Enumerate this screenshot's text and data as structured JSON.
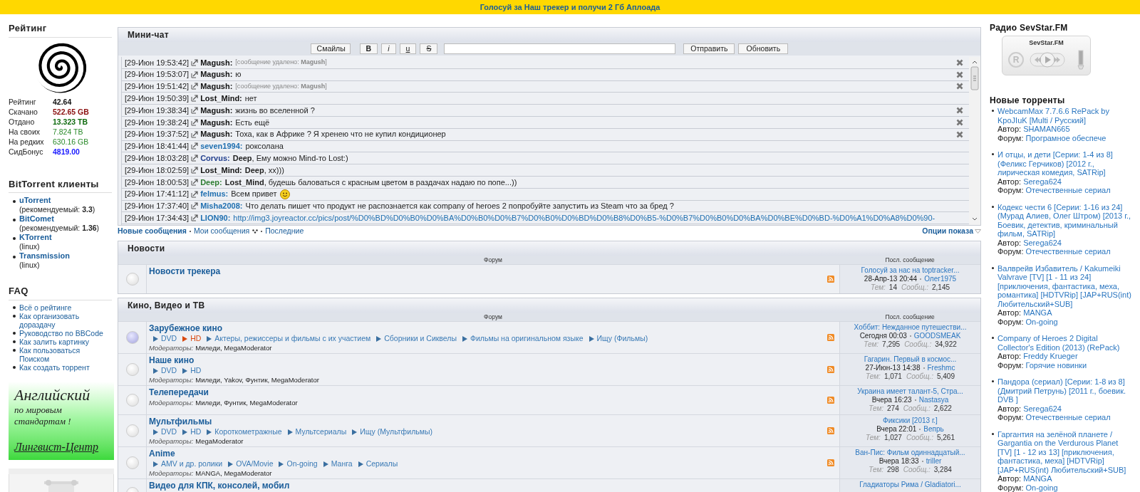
{
  "banner": {
    "text": "Голосуй за Наш трекер и получи 2 Гб Аплоада"
  },
  "left": {
    "rating": {
      "title": "Рейтинг",
      "stats": [
        {
          "label": "Рейтинг",
          "value": "42.64",
          "color": "#111111",
          "bold": true
        },
        {
          "label": "Скачано",
          "value": "522.65 GB",
          "color": "#8b1010",
          "bold": true
        },
        {
          "label": "Отдано",
          "value": "13.323 TB",
          "color": "#0f6b0f",
          "bold": true
        },
        {
          "label": "На своих",
          "value": "7.824 TB",
          "color": "#2a8a2a",
          "bold": false
        },
        {
          "label": "На редких",
          "value": "630.16 GB",
          "color": "#2a8a2a",
          "bold": false
        },
        {
          "label": "СидБонус",
          "value": "4819.00",
          "color": "#1a1aff",
          "bold": true
        }
      ]
    },
    "clients": {
      "title": "BitTorrent клиенты",
      "items": [
        {
          "name": "uTorrent",
          "note": "(рекомендуемый: **3.3**)"
        },
        {
          "name": "BitComet",
          "note": "(рекомендуемый: **1.36**)"
        },
        {
          "name": "KTorrent",
          "note": "(linux)"
        },
        {
          "name": "Transmission",
          "note": "(linux)"
        }
      ]
    },
    "faq": {
      "title": "FAQ",
      "links": [
        "Всё о рейтинге",
        "Как организовать дораздачу",
        "Руководство по BBCode",
        "Как залить картинку",
        "Как пользоваться Поиском",
        "Как создать торрент"
      ]
    },
    "ad": {
      "headline": "Английский",
      "tagline": "по мировым стандартам !",
      "brand": "Лингвист-Центр"
    }
  },
  "chat": {
    "title": "Мини-чат",
    "toolbar": {
      "smileys": "Смайлы",
      "bold": "B",
      "italic": "i",
      "underline": "u",
      "strike": "S",
      "send": "Отправить",
      "refresh": "Обновить"
    },
    "messages": [
      {
        "time": "[29-Июн 19:53:42]",
        "author": "Magush:",
        "color": "#111111",
        "kind": "deleted",
        "text": "[сообщение удалено: **Magush**]",
        "deletable": true
      },
      {
        "time": "[29-Июн 19:53:07]",
        "author": "Magush:",
        "color": "#111111",
        "kind": "text",
        "text": "ю",
        "deletable": true
      },
      {
        "time": "[29-Июн 19:51:42]",
        "author": "Magush:",
        "color": "#111111",
        "kind": "deleted",
        "text": "[сообщение удалено: **Magush**]",
        "deletable": true
      },
      {
        "time": "[29-Июн 19:50:39]",
        "author": "Lost_Mind:",
        "color": "#111111",
        "kind": "text",
        "text": "нет",
        "deletable": false
      },
      {
        "time": "[29-Июн 19:38:34]",
        "author": "Magush:",
        "color": "#111111",
        "kind": "text",
        "text": "жизнь во вселенной ?",
        "deletable": true
      },
      {
        "time": "[29-Июн 19:38:24]",
        "author": "Magush:",
        "color": "#111111",
        "kind": "text",
        "text": "Есть ещё",
        "deletable": true
      },
      {
        "time": "[29-Июн 19:37:52]",
        "author": "Magush:",
        "color": "#111111",
        "kind": "text",
        "text": "Тоха, как в Африке ? Я хренею что не купил кондиционер",
        "deletable": true
      },
      {
        "time": "[29-Июн 18:41:44]",
        "author": "seven1994:",
        "color": "#1f6fb0",
        "kind": "text",
        "text": "роксолана",
        "deletable": false
      },
      {
        "time": "[29-Июн 18:03:28]",
        "author": "Corvus:",
        "color": "#23408e",
        "kind": "text",
        "text": "**Deep**, Ему можно Mind-то Lost:)",
        "deletable": false
      },
      {
        "time": "[29-Июн 18:02:59]",
        "author": "Lost_Mind:",
        "color": "#111111",
        "kind": "text",
        "text": "**Deep**, xx)))",
        "deletable": false
      },
      {
        "time": "[29-Июн 18:00:53]",
        "author": "Deep:",
        "color": "#2e7d32",
        "kind": "text",
        "text": "**Lost_Mind**, будешь баловаться с красным цветом в раздачах надаю по попе...))",
        "deletable": false
      },
      {
        "time": "[29-Июн 17:41:12]",
        "author": "felmus:",
        "color": "#1f6fb0",
        "kind": "smiley",
        "text": "Всем привет",
        "deletable": false
      },
      {
        "time": "[29-Июн 17:37:40]",
        "author": "Misha2008:",
        "color": "#1f6fb0",
        "kind": "text",
        "text": "Что делать пишет что продукт не распознается как company of heroes 2 попробуйте запустить из Steam что за бред ?",
        "deletable": false
      },
      {
        "time": "[29-Июн 17:34:43]",
        "author": "LION90:",
        "color": "#1f6fb0",
        "kind": "link",
        "text": "http://img3.joyreactor.cc/pics/post/%D0%BD%D0%B0%D0%BA%D0%B0%D0%B7%D0%B0%D0%BD%D0%B8%D0%B5-%D0%B7%D0%B0%D0%BA%D0%BE%D0%BD-%D0%A1%D0%A8%D0%90-",
        "deletable": false
      }
    ],
    "footer": {
      "new": "Новые сообщения",
      "mine": "Мои сообщения",
      "recent": "Последние",
      "options": "Опции показа"
    }
  },
  "categories": [
    {
      "title": "Новости",
      "col_forum": "Форум",
      "col_last": "Посл. сообщение",
      "forums": [
        {
          "name": "Новости трекера",
          "unread": false,
          "last": {
            "title": "Голосуй за нас на toptracker...",
            "date": "28-Апр-13 20:44",
            "author": "Олег1975",
            "topics_label": "Тем:",
            "topics": "14",
            "posts_label": "Сообщ.:",
            "posts": "2,145"
          }
        }
      ]
    },
    {
      "title": "Кино, Видео и ТВ",
      "col_forum": "Форум",
      "col_last": "Посл. сообщение",
      "forums": [
        {
          "name": "Зарубежное кино",
          "unread": true,
          "subforums": [
            {
              "label": "DVD",
              "new": false
            },
            {
              "label": "HD",
              "new": true
            },
            {
              "label": "Актеры, режиссеры и фильмы с их участием",
              "new": false
            },
            {
              "label": "Сборники и Сиквелы",
              "new": false
            },
            {
              "label": "Фильмы на оригинальном языке",
              "new": false
            },
            {
              "label": "Ищу (Фильмы)",
              "new": false
            }
          ],
          "moderators_label": "Модераторы:",
          "moderators": "Миледи, MegaModerator",
          "last": {
            "title": "Хоббит: Нежданное путешестви...",
            "date": "Сегодня 00:03",
            "author": "GOODSMEAK",
            "topics_label": "Тем:",
            "topics": "7,295",
            "posts_label": "Сообщ.:",
            "posts": "34,922"
          }
        },
        {
          "name": "Наше кино",
          "unread": false,
          "subforums": [
            {
              "label": "DVD",
              "new": false
            },
            {
              "label": "HD",
              "new": false
            }
          ],
          "moderators_label": "Модераторы:",
          "moderators": "Миледи, Yakov, Фунтик, MegaModerator",
          "last": {
            "title": "Гагарин. Первый в космос...",
            "date": "27-Июн-13 14:38",
            "author": "Freshmc",
            "topics_label": "Тем:",
            "topics": "1,071",
            "posts_label": "Сообщ.:",
            "posts": "5,409"
          }
        },
        {
          "name": "Телепередачи",
          "unread": false,
          "moderators_label": "Модераторы:",
          "moderators": "Миледи, Фунтик, MegaModerator",
          "last": {
            "title": "Украина имеет талант-5, Стра...",
            "date": "Вчера 16:23",
            "author": "Nastasya",
            "topics_label": "Тем:",
            "topics": "274",
            "posts_label": "Сообщ.:",
            "posts": "2,622"
          }
        },
        {
          "name": "Мультфильмы",
          "unread": false,
          "subforums": [
            {
              "label": "DVD",
              "new": false
            },
            {
              "label": "HD",
              "new": false
            },
            {
              "label": "Короткометражные",
              "new": false
            },
            {
              "label": "Мультсериалы",
              "new": false
            },
            {
              "label": "Ищу (Мультфильмы)",
              "new": false
            }
          ],
          "moderators_label": "Модераторы:",
          "moderators": "MegaModerator",
          "last": {
            "title": "Фиксики [2013 г.]",
            "date": "Вчера 22:01",
            "author": "Вепрь",
            "topics_label": "Тем:",
            "topics": "1,027",
            "posts_label": "Сообщ.:",
            "posts": "5,261"
          }
        },
        {
          "name": "Anime",
          "unread": false,
          "subforums": [
            {
              "label": "AMV и др. ролики",
              "new": false
            },
            {
              "label": "OVA/Movie",
              "new": false
            },
            {
              "label": "On-going",
              "new": false
            },
            {
              "label": "Манга",
              "new": false
            },
            {
              "label": "Сериалы",
              "new": false
            }
          ],
          "moderators_label": "Модераторы:",
          "moderators": "MANGA, MegaModerator",
          "last": {
            "title": "Ван-Пис: Фильм одиннадцатый...",
            "date": "Вчера 18:33",
            "author": "triller",
            "topics_label": "Тем:",
            "topics": "298",
            "posts_label": "Сообщ.:",
            "posts": "3,284"
          }
        },
        {
          "name": "Видео для КПК, консолей, мобил",
          "unread": false,
          "last": {
            "title": "Гладиаторы Рима / Gladiatori..."
          }
        }
      ]
    }
  ],
  "right": {
    "radio": {
      "title": "Радио SevStar.FM",
      "station": "SevStar.FM",
      "logo_letter": "R"
    },
    "torrents": {
      "title": "Новые торренты",
      "items": [
        {
          "title": "WebcamMax 7.7.6.6 RePack by KpoJIuK [Multi / Русский]",
          "author_label": "Автор:",
          "author": "SHAMAN665",
          "forum_label": "Форум:",
          "forum": "Програмное обеспече"
        },
        {
          "title": "И отцы, и дети [Серии: 1-4 из 8] (Феликс Герчиков) [2012 г., лирическая комедия, SATRip]",
          "author_label": "Автор:",
          "author": "Serega624",
          "forum_label": "Форум:",
          "forum": "Отечественные сериал"
        },
        {
          "title": "Кодекс чести 6 [Серии: 1-16 из 24] (Мурад Алиев, Олег Штром) [2013 г., Боевик, детектив, криминальный фильм, SATRip]",
          "author_label": "Автор:",
          "author": "Serega624",
          "forum_label": "Форум:",
          "forum": "Отечественные сериал"
        },
        {
          "title": "Валврейв Избавитель / Kakumeiki Valvrave [TV] [1 - 11 из 24] [приключения, фантастика, меха, романтика] [HDTVRip] [JAP+RUS(int) Любительский+SUB]",
          "author_label": "Автор:",
          "author": "MANGA",
          "forum_label": "Форум:",
          "forum": "On-going"
        },
        {
          "title": "Company of Heroes 2 Digital Collector's Edition (2013) (RePack)",
          "author_label": "Автор:",
          "author": "Freddy Krueger",
          "forum_label": "Форум:",
          "forum": "Горячие новинки"
        },
        {
          "title": "Пандора (сериал) [Серии: 1-8 из 8] (Дмитрий Петрунь) [2011 г., боевик. DVB ]",
          "author_label": "Автор:",
          "author": "Serega624",
          "forum_label": "Форум:",
          "forum": "Отечественные сериал"
        },
        {
          "title": "Гаргантия на зелёной планете / Gargantia on the Verdurous Planet [TV] [1 - 12 из 13] [приключения, фантастика, меха] [HDTVRip] [JAP+RUS(int) Любительский+SUB]",
          "author_label": "Автор:",
          "author": "MANGA",
          "forum_label": "Форум:",
          "forum": "On-going"
        }
      ]
    }
  }
}
